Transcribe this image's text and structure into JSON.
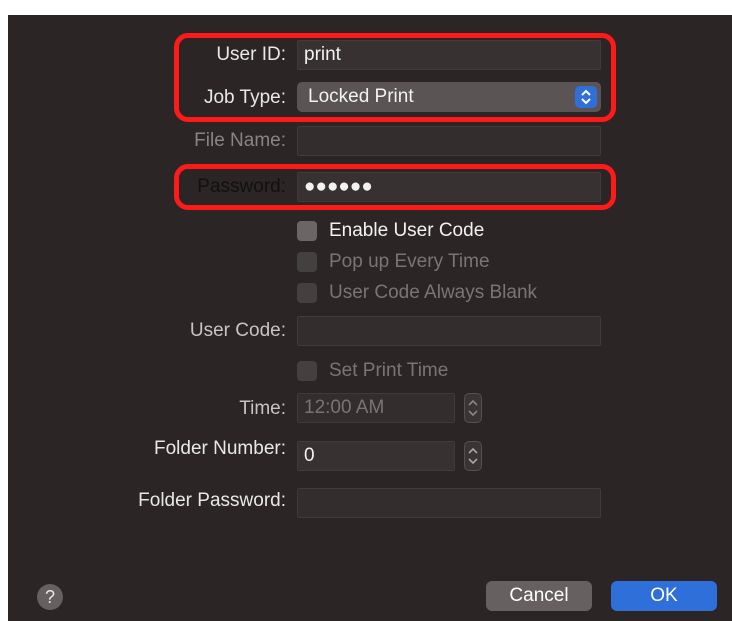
{
  "form": {
    "user_id_label": "User ID:",
    "user_id_value": "print",
    "job_type_label": "Job Type:",
    "job_type_value": "Locked Print",
    "file_name_label": "File Name:",
    "file_name_value": "",
    "password_label": "Password:",
    "password_value": "●●●●●●",
    "enable_user_code_label": "Enable User Code",
    "pop_up_every_time_label": "Pop up Every Time",
    "user_code_always_blank_label": "User Code Always Blank",
    "user_code_label": "User Code:",
    "user_code_value": "",
    "set_print_time_label": "Set Print Time",
    "time_label": "Time:",
    "time_value": "12:00 AM",
    "folder_number_label": "Folder Number:",
    "folder_number_value": "0",
    "folder_password_label": "Folder Password:",
    "folder_password_value": ""
  },
  "footer": {
    "help_label": "?",
    "cancel_label": "Cancel",
    "ok_label": "OK"
  },
  "colors": {
    "background": "#2b2525",
    "accent": "#2f6fd9",
    "highlight": "#ff1a1a"
  }
}
